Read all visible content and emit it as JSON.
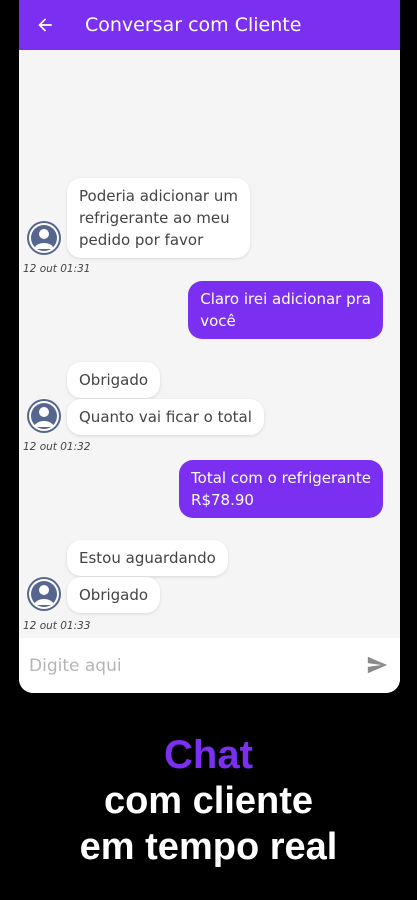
{
  "header": {
    "title": "Conversar com Cliente",
    "back_icon": "arrow-left-icon"
  },
  "messages": [
    {
      "from": "customer",
      "text": [
        "Poderia adicionar um",
        "refrigerante ao meu",
        "pedido por favor"
      ]
    },
    {
      "timestamp": "12 out 01:31"
    },
    {
      "from": "store",
      "text": [
        "Claro irei adicionar pra",
        "você"
      ]
    },
    {
      "from": "customer",
      "text": [
        "Obrigado"
      ]
    },
    {
      "from": "customer",
      "text": [
        "Quanto vai ficar o total"
      ]
    },
    {
      "timestamp": "12 out 01:32"
    },
    {
      "from": "store",
      "text": [
        "Total com o refrigerante",
        "R$78.90"
      ]
    },
    {
      "from": "customer",
      "text": [
        "Estou aguardando"
      ]
    },
    {
      "from": "customer",
      "text": [
        "Obrigado"
      ]
    },
    {
      "timestamp": "12 out 01:33"
    }
  ],
  "composer": {
    "placeholder": "Digite aqui",
    "send_icon": "send-icon"
  },
  "promo": {
    "line1": "Chat",
    "line2": "com cliente",
    "line3": "em tempo real"
  },
  "colors": {
    "accent": "#7b2ff0",
    "background": "#000000",
    "chat_background": "#f5f5f5",
    "avatar": "#56668f"
  }
}
